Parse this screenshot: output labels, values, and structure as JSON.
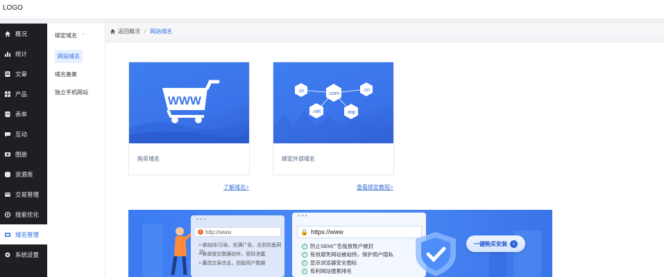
{
  "logo": "LOGO",
  "sidebar": {
    "items": [
      {
        "label": "概况",
        "icon": "home-icon"
      },
      {
        "label": "统计",
        "icon": "chart-icon"
      },
      {
        "label": "文章",
        "icon": "article-icon"
      },
      {
        "label": "产品",
        "icon": "grid-icon"
      },
      {
        "label": "表单",
        "icon": "form-icon"
      },
      {
        "label": "互动",
        "icon": "chat-icon"
      },
      {
        "label": "图册",
        "icon": "album-icon"
      },
      {
        "label": "资源库",
        "icon": "database-icon"
      },
      {
        "label": "交易管理",
        "icon": "trade-icon"
      },
      {
        "label": "搜索优化",
        "icon": "seo-icon"
      },
      {
        "label": "域名管理",
        "icon": "domain-icon",
        "active": true
      },
      {
        "label": "系统设置",
        "icon": "gear-icon"
      }
    ]
  },
  "subnav": {
    "group": "绑定域名",
    "items": [
      {
        "label": "网站域名",
        "active": true
      },
      {
        "label": "域名备案"
      },
      {
        "label": "独立手机网站"
      }
    ]
  },
  "breadcrumb": {
    "back": "返回概况",
    "current": "网站域名"
  },
  "cards": [
    {
      "caption": "购买域名",
      "banner_text": "WWW"
    },
    {
      "caption": "绑定外部域名",
      "tags": [
        ".cc",
        ".com",
        ".cn",
        ".net",
        ".top"
      ]
    }
  ],
  "links": {
    "learn": "了解域名>",
    "tutorial": "查看绑定教程>"
  },
  "promo": {
    "bad_url": "http://www",
    "bad_points": [
      "被劫持/污染，充满广告，去到钓鱼网站",
      "表单提交数据窃听，密码泄露",
      "篡改交易信息，窃取用户数据"
    ],
    "good_url": "https://www",
    "good_points": [
      "防止SEM广告投放账户被封",
      "有效避免网站被劫持，保护用户隐私",
      "显示浏览器安全图标",
      "有利网站搜索排名"
    ],
    "cta": "一键购买安装"
  },
  "colors": {
    "accent": "#2b6de0",
    "sidebar_bg": "#1d1f22",
    "banner": "#3b74ea"
  }
}
